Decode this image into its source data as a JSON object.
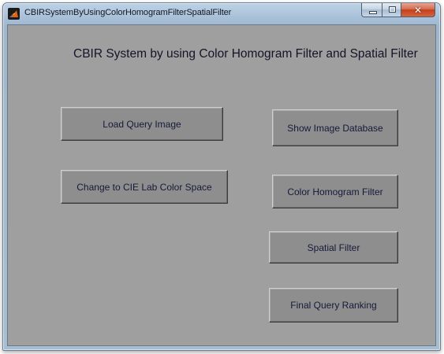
{
  "window": {
    "title": "CBIRSystemByUsingColorHomogramFilterSpatialFilter",
    "icon": "matlab-icon",
    "controls": {
      "minimize_icon": "minimize-icon",
      "maximize_icon": "maximize-icon",
      "close_icon": "close-icon",
      "close_glyph": "✕"
    }
  },
  "main": {
    "heading": "CBIR System by using Color Homogram Filter and Spatial Filter",
    "buttons": {
      "load_query_image": "Load Query Image",
      "change_color_space": "Change to CIE Lab Color Space",
      "show_image_database": "Show Image Database",
      "color_homogram_filter": "Color Homogram Filter",
      "spatial_filter": "Spatial Filter",
      "final_query_ranking": "Final Query Ranking"
    }
  },
  "colors": {
    "background": "#9f9f9f",
    "button_face": "#8e8e8e",
    "text": "#161a3a",
    "close_button": "#c2401c"
  }
}
